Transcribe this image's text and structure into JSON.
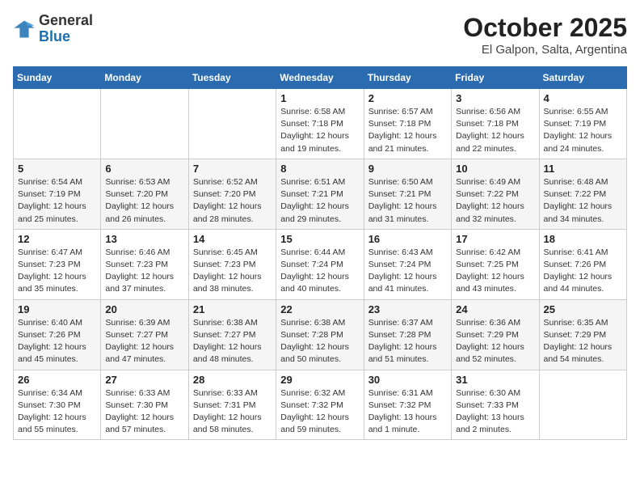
{
  "header": {
    "logo_general": "General",
    "logo_blue": "Blue",
    "title": "October 2025",
    "subtitle": "El Galpon, Salta, Argentina"
  },
  "weekdays": [
    "Sunday",
    "Monday",
    "Tuesday",
    "Wednesday",
    "Thursday",
    "Friday",
    "Saturday"
  ],
  "weeks": [
    [
      {
        "day": "",
        "info": ""
      },
      {
        "day": "",
        "info": ""
      },
      {
        "day": "",
        "info": ""
      },
      {
        "day": "1",
        "info": "Sunrise: 6:58 AM\nSunset: 7:18 PM\nDaylight: 12 hours and 19 minutes."
      },
      {
        "day": "2",
        "info": "Sunrise: 6:57 AM\nSunset: 7:18 PM\nDaylight: 12 hours and 21 minutes."
      },
      {
        "day": "3",
        "info": "Sunrise: 6:56 AM\nSunset: 7:18 PM\nDaylight: 12 hours and 22 minutes."
      },
      {
        "day": "4",
        "info": "Sunrise: 6:55 AM\nSunset: 7:19 PM\nDaylight: 12 hours and 24 minutes."
      }
    ],
    [
      {
        "day": "5",
        "info": "Sunrise: 6:54 AM\nSunset: 7:19 PM\nDaylight: 12 hours and 25 minutes."
      },
      {
        "day": "6",
        "info": "Sunrise: 6:53 AM\nSunset: 7:20 PM\nDaylight: 12 hours and 26 minutes."
      },
      {
        "day": "7",
        "info": "Sunrise: 6:52 AM\nSunset: 7:20 PM\nDaylight: 12 hours and 28 minutes."
      },
      {
        "day": "8",
        "info": "Sunrise: 6:51 AM\nSunset: 7:21 PM\nDaylight: 12 hours and 29 minutes."
      },
      {
        "day": "9",
        "info": "Sunrise: 6:50 AM\nSunset: 7:21 PM\nDaylight: 12 hours and 31 minutes."
      },
      {
        "day": "10",
        "info": "Sunrise: 6:49 AM\nSunset: 7:22 PM\nDaylight: 12 hours and 32 minutes."
      },
      {
        "day": "11",
        "info": "Sunrise: 6:48 AM\nSunset: 7:22 PM\nDaylight: 12 hours and 34 minutes."
      }
    ],
    [
      {
        "day": "12",
        "info": "Sunrise: 6:47 AM\nSunset: 7:23 PM\nDaylight: 12 hours and 35 minutes."
      },
      {
        "day": "13",
        "info": "Sunrise: 6:46 AM\nSunset: 7:23 PM\nDaylight: 12 hours and 37 minutes."
      },
      {
        "day": "14",
        "info": "Sunrise: 6:45 AM\nSunset: 7:23 PM\nDaylight: 12 hours and 38 minutes."
      },
      {
        "day": "15",
        "info": "Sunrise: 6:44 AM\nSunset: 7:24 PM\nDaylight: 12 hours and 40 minutes."
      },
      {
        "day": "16",
        "info": "Sunrise: 6:43 AM\nSunset: 7:24 PM\nDaylight: 12 hours and 41 minutes."
      },
      {
        "day": "17",
        "info": "Sunrise: 6:42 AM\nSunset: 7:25 PM\nDaylight: 12 hours and 43 minutes."
      },
      {
        "day": "18",
        "info": "Sunrise: 6:41 AM\nSunset: 7:26 PM\nDaylight: 12 hours and 44 minutes."
      }
    ],
    [
      {
        "day": "19",
        "info": "Sunrise: 6:40 AM\nSunset: 7:26 PM\nDaylight: 12 hours and 45 minutes."
      },
      {
        "day": "20",
        "info": "Sunrise: 6:39 AM\nSunset: 7:27 PM\nDaylight: 12 hours and 47 minutes."
      },
      {
        "day": "21",
        "info": "Sunrise: 6:38 AM\nSunset: 7:27 PM\nDaylight: 12 hours and 48 minutes."
      },
      {
        "day": "22",
        "info": "Sunrise: 6:38 AM\nSunset: 7:28 PM\nDaylight: 12 hours and 50 minutes."
      },
      {
        "day": "23",
        "info": "Sunrise: 6:37 AM\nSunset: 7:28 PM\nDaylight: 12 hours and 51 minutes."
      },
      {
        "day": "24",
        "info": "Sunrise: 6:36 AM\nSunset: 7:29 PM\nDaylight: 12 hours and 52 minutes."
      },
      {
        "day": "25",
        "info": "Sunrise: 6:35 AM\nSunset: 7:29 PM\nDaylight: 12 hours and 54 minutes."
      }
    ],
    [
      {
        "day": "26",
        "info": "Sunrise: 6:34 AM\nSunset: 7:30 PM\nDaylight: 12 hours and 55 minutes."
      },
      {
        "day": "27",
        "info": "Sunrise: 6:33 AM\nSunset: 7:30 PM\nDaylight: 12 hours and 57 minutes."
      },
      {
        "day": "28",
        "info": "Sunrise: 6:33 AM\nSunset: 7:31 PM\nDaylight: 12 hours and 58 minutes."
      },
      {
        "day": "29",
        "info": "Sunrise: 6:32 AM\nSunset: 7:32 PM\nDaylight: 12 hours and 59 minutes."
      },
      {
        "day": "30",
        "info": "Sunrise: 6:31 AM\nSunset: 7:32 PM\nDaylight: 13 hours and 1 minute."
      },
      {
        "day": "31",
        "info": "Sunrise: 6:30 AM\nSunset: 7:33 PM\nDaylight: 13 hours and 2 minutes."
      },
      {
        "day": "",
        "info": ""
      }
    ]
  ]
}
